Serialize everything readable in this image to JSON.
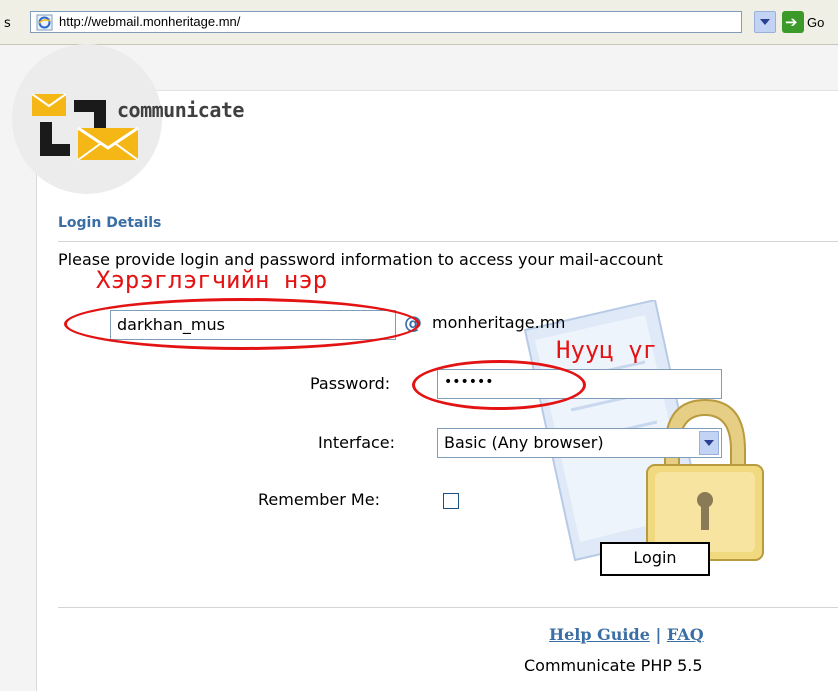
{
  "browser": {
    "address_edge": "s",
    "url": "http://webmail.monheritage.mn/",
    "go_label": "Go"
  },
  "brand": {
    "name": "communicate",
    "accent": "#f5b716"
  },
  "login": {
    "section_title": "Login Details",
    "instruction": "Please provide login and password information to access your mail-account",
    "username_value": "darkhan_mus",
    "at_symbol": "@",
    "domain": "monheritage.mn",
    "password_label": "Password:",
    "password_value": "••••••",
    "interface_label": "Interface:",
    "interface_value": "Basic (Any browser)",
    "remember_label": "Remember Me:",
    "remember_checked": false,
    "login_button": "Login"
  },
  "footer": {
    "help_link": "Help Guide",
    "separator": "|",
    "faq_link": "FAQ",
    "version": "Communicate PHP 5.5"
  },
  "annotations": {
    "username_label": "Хэрэглэгчийн нэр",
    "password_label": "Нууц үг",
    "color": "#e41313"
  }
}
